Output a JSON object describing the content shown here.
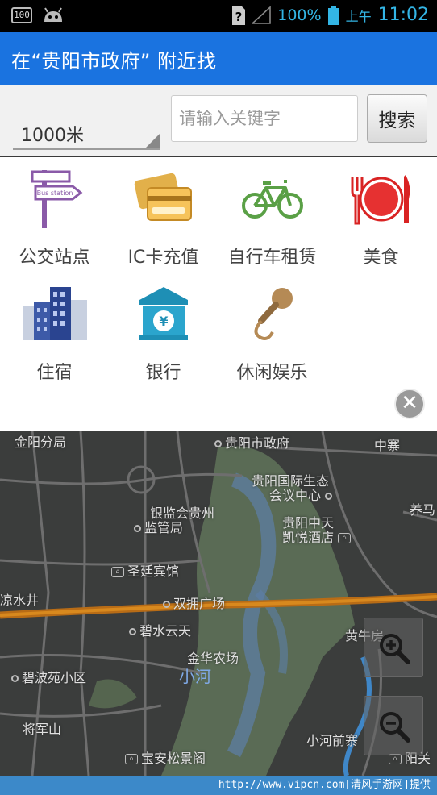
{
  "status_bar": {
    "badge": "100",
    "battery": "100%",
    "ampm": "上午",
    "time": "11:02"
  },
  "header": {
    "title": "在“贵阳市政府” 附近找"
  },
  "search": {
    "distance": "1000米",
    "placeholder": "请输入关键字",
    "button_label": "搜索"
  },
  "categories": [
    {
      "label": "公交站点",
      "icon": "bus-station-sign-icon",
      "icon_text": "Bus station"
    },
    {
      "label": "IC卡充值",
      "icon": "ic-card-icon"
    },
    {
      "label": "自行车租赁",
      "icon": "bicycle-icon"
    },
    {
      "label": "美食",
      "icon": "food-plate-icon"
    },
    {
      "label": "住宿",
      "icon": "hotel-building-icon"
    },
    {
      "label": "银行",
      "icon": "bank-icon",
      "icon_text": "¥"
    },
    {
      "label": "休闲娱乐",
      "icon": "microphone-icon"
    }
  ],
  "map": {
    "pois": [
      {
        "name": "金阳分局"
      },
      {
        "name": "贵阳市政府"
      },
      {
        "name": "中寨"
      },
      {
        "name": "贵阳国际生态"
      },
      {
        "name": "会议中心"
      },
      {
        "name": "养马"
      },
      {
        "name": "银监会贵州"
      },
      {
        "name": "监管局"
      },
      {
        "name": "贵阳中天"
      },
      {
        "name": "凯悦酒店"
      },
      {
        "name": "圣廷宾馆"
      },
      {
        "name": "凉水井"
      },
      {
        "name": "双拥广场"
      },
      {
        "name": "碧水云天"
      },
      {
        "name": "黄牛房"
      },
      {
        "name": "金华农场"
      },
      {
        "name": "小河"
      },
      {
        "name": "碧波苑小区"
      },
      {
        "name": "将军山"
      },
      {
        "name": "小河前寨"
      },
      {
        "name": "宝安松景阁"
      },
      {
        "name": "阳关"
      }
    ],
    "zoom_in_icon": "zoom-in-icon",
    "zoom_out_icon": "zoom-out-icon"
  },
  "footer": {
    "text": "http://www.vipcn.com[清风手游网]提供"
  }
}
